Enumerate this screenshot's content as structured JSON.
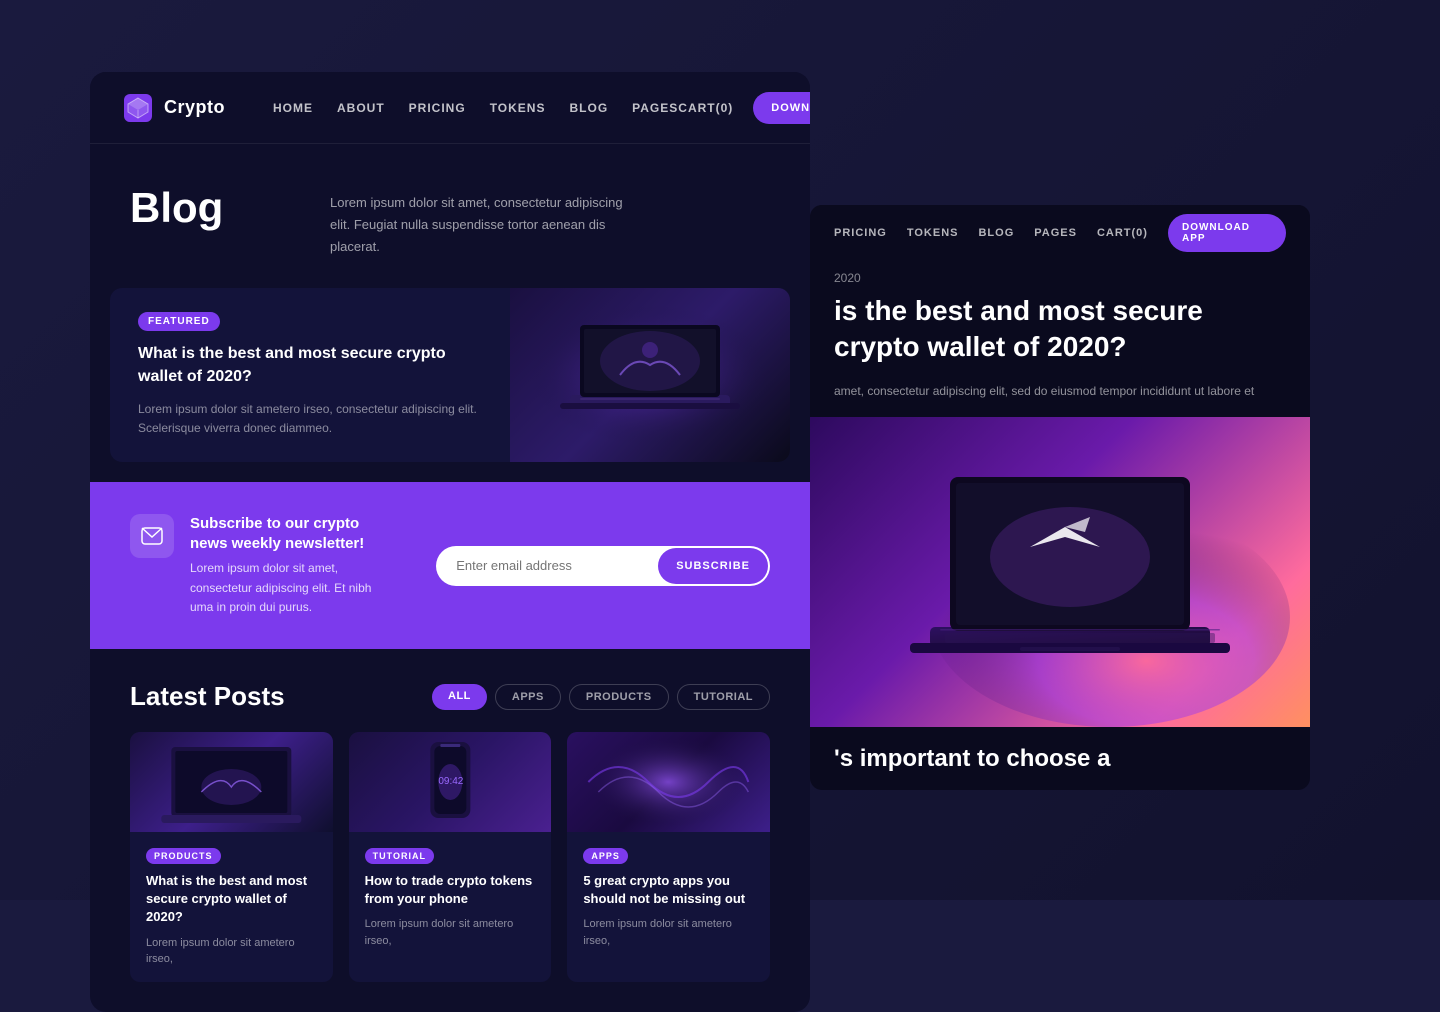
{
  "background_color": "#1a1a3e",
  "main_card": {
    "navbar": {
      "logo_text": "Crypto",
      "nav_links": [
        "HOME",
        "ABOUT",
        "PRICING",
        "TOKENS",
        "BLOG",
        "PAGES"
      ],
      "cart_label": "CART(0)",
      "download_label": "DOWNLOAD APP"
    },
    "blog_section": {
      "title": "Blog",
      "description": "Lorem ipsum dolor sit amet, consectetur adipiscing elit. Feugiat nulla suspendisse tortor aenean dis placerat."
    },
    "featured_post": {
      "badge": "FEATURED",
      "title": "What is the best and most secure crypto wallet of 2020?",
      "excerpt": "Lorem ipsum dolor sit ametero irseo, consectetur adipiscing elit. Scelerisque viverra donec diammeo."
    },
    "newsletter": {
      "title": "Subscribe to our crypto news weekly newsletter!",
      "description": "Lorem ipsum dolor sit amet, consectetur adipiscing elit. Et nibh uma in proin dui purus.",
      "input_placeholder": "Enter email address",
      "subscribe_label": "SUBSCRIBE"
    },
    "latest_posts": {
      "title": "Latest Posts",
      "filters": [
        {
          "label": "ALL",
          "active": true
        },
        {
          "label": "APPS",
          "active": false
        },
        {
          "label": "PRODUCTS",
          "active": false
        },
        {
          "label": "TUTORIAL",
          "active": false
        }
      ],
      "posts": [
        {
          "badge": "PRODUCTS",
          "badge_type": "products",
          "title": "What is the best and most secure crypto wallet of 2020?",
          "excerpt": "Lorem ipsum dolor sit ametero irseo,"
        },
        {
          "badge": "TUTORIAL",
          "badge_type": "tutorial",
          "title": "How to trade crypto tokens from your phone",
          "excerpt": "Lorem ipsum dolor sit ametero irseo,"
        },
        {
          "badge": "APPS",
          "badge_type": "apps",
          "title": "5 great crypto apps you should not be missing out",
          "excerpt": "Lorem ipsum dolor sit ametero irseo,"
        }
      ]
    }
  },
  "right_card": {
    "navbar": {
      "nav_links": [
        "PRICING",
        "TOKENS",
        "BLOG",
        "PAGES"
      ],
      "cart_label": "CART(0)",
      "download_label": "DOWNLOAD APP"
    },
    "article": {
      "date": "2020",
      "title": "is the best and most secure crypto wallet of 2020?",
      "excerpt": "amet, consectetur adipiscing elit, sed do eiusmod tempor incididunt ut labore et",
      "bottom_text": "'s important to choose a"
    }
  }
}
